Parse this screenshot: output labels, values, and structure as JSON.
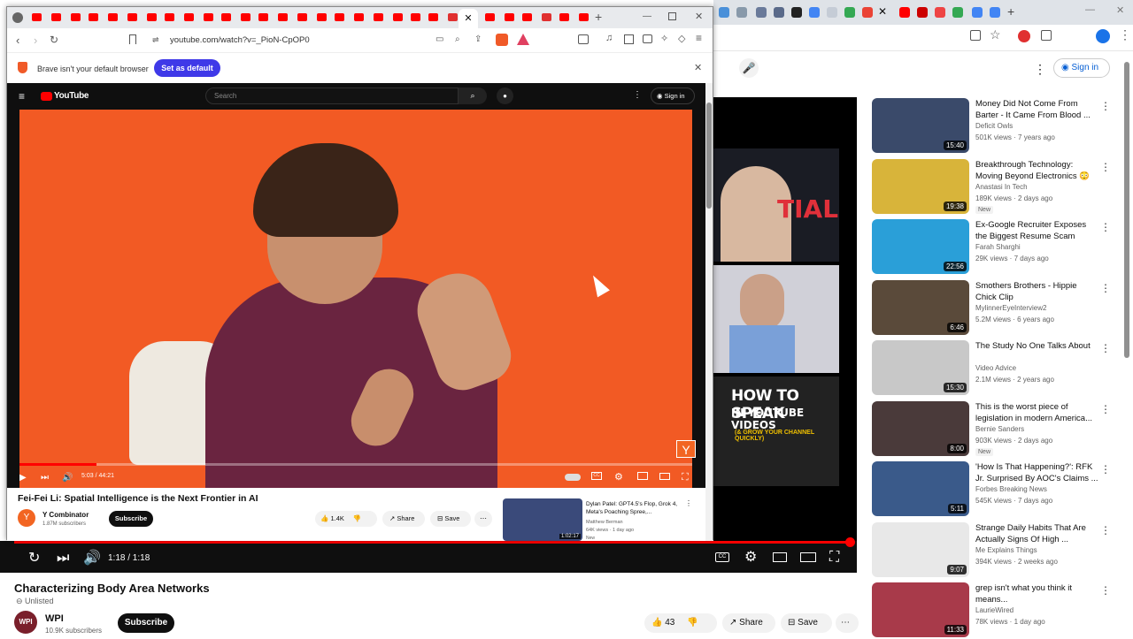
{
  "front": {
    "address": "youtube.com/watch?v=_PioN-CpOP0",
    "notice_text": "Brave isn't your default browser",
    "notice_button": "Set as default",
    "yt_logo": "YouTube",
    "search_placeholder": "Search",
    "sign_in": "Sign in",
    "time": "5:03 / 44:21",
    "progress": 0.114,
    "video_title": "Fei-Fei Li: Spatial Intelligence is the Next Frontier in AI",
    "channel": "Y Combinator",
    "subs": "1.87M subscribers",
    "subscribe": "Subscribe",
    "likes": "1.4K",
    "share": "Share",
    "save": "Save",
    "up_next_title": "Dylan Patel: GPT4.5's Flop, Grok 4, Meta's Poaching Spree,...",
    "up_next_channel": "Matthew Berman",
    "up_next_meta": "64K views · 1 day ago",
    "up_next_new": "New",
    "up_next_duration": "1:02:17",
    "yc_badge": "Y"
  },
  "back": {
    "sign_in": "Sign in",
    "time": "1:18 / 1:18",
    "progress": 1.0,
    "video_title": "Characterizing Body Area Networks",
    "unlisted": "Unlisted",
    "channel": "WPI",
    "avatar_text": "WPI",
    "subs": "10.9K subscribers",
    "subscribe": "Subscribe",
    "likes": "43",
    "share": "Share",
    "save": "Save",
    "thumb_1_text": "TIAL",
    "thumb_3_line1": "HOW TO SPEAK",
    "thumb_3_line2": "IN YOUTUBE VIDEOS",
    "thumb_3_line3": "(& GROW YOUR CHANNEL QUICKLY)"
  },
  "recommendations": [
    {
      "title": "Money Did Not Come From Barter - It Came From Blood ...",
      "channel": "Deficit Owls",
      "meta": "501K views · 7 years ago",
      "duration": "15:40",
      "new": "",
      "thumb_color": "#3a4a6a"
    },
    {
      "title": "Breakthrough Technology: Moving Beyond Electronics 😳",
      "channel": "Anastasi In Tech",
      "meta": "189K views · 2 days ago",
      "duration": "19:38",
      "new": "New",
      "thumb_color": "#d8b43a"
    },
    {
      "title": "Ex-Google Recruiter Exposes the Biggest Resume Scam",
      "channel": "Farah Sharghi",
      "meta": "29K views · 7 days ago",
      "duration": "22:56",
      "new": "",
      "thumb_color": "#2a9fd8"
    },
    {
      "title": "Smothers Brothers - Hippie Chick Clip",
      "channel": "MylinnerEyeInterview2",
      "meta": "5.2M views · 6 years ago",
      "duration": "6:46",
      "new": "",
      "thumb_color": "#5a4a3a"
    },
    {
      "title": "The Study No One Talks About",
      "channel": "Video Advice",
      "meta": "2.1M views · 2 years ago",
      "duration": "15:30",
      "new": "",
      "thumb_color": "#c8c8c8"
    },
    {
      "title": "This is the worst piece of legislation in modern America...",
      "channel": "Bernie Sanders",
      "meta": "903K views · 2 days ago",
      "duration": "8:00",
      "new": "New",
      "thumb_color": "#4a3a3a"
    },
    {
      "title": "'How Is That Happening?': RFK Jr. Surprised By AOC's Claims ...",
      "channel": "Forbes Breaking News",
      "meta": "545K views · 7 days ago",
      "duration": "5:11",
      "new": "",
      "thumb_color": "#3a5a8a"
    },
    {
      "title": "Strange Daily Habits That Are Actually Signs Of High ...",
      "channel": "Me Explains Things",
      "meta": "394K views · 2 weeks ago",
      "duration": "9:07",
      "new": "",
      "thumb_color": "#e8e8e8"
    },
    {
      "title": "grep isn't what you think it means...",
      "channel": "LaurieWired",
      "meta": "78K views · 1 day ago",
      "duration": "11:33",
      "new": "",
      "thumb_color": "#a83a4a"
    }
  ],
  "colors": {
    "red": "#ff0000",
    "brave_blue": "#3f39e8",
    "yt_dark": "#0f0f0f",
    "video_bg": "#f25a24"
  }
}
